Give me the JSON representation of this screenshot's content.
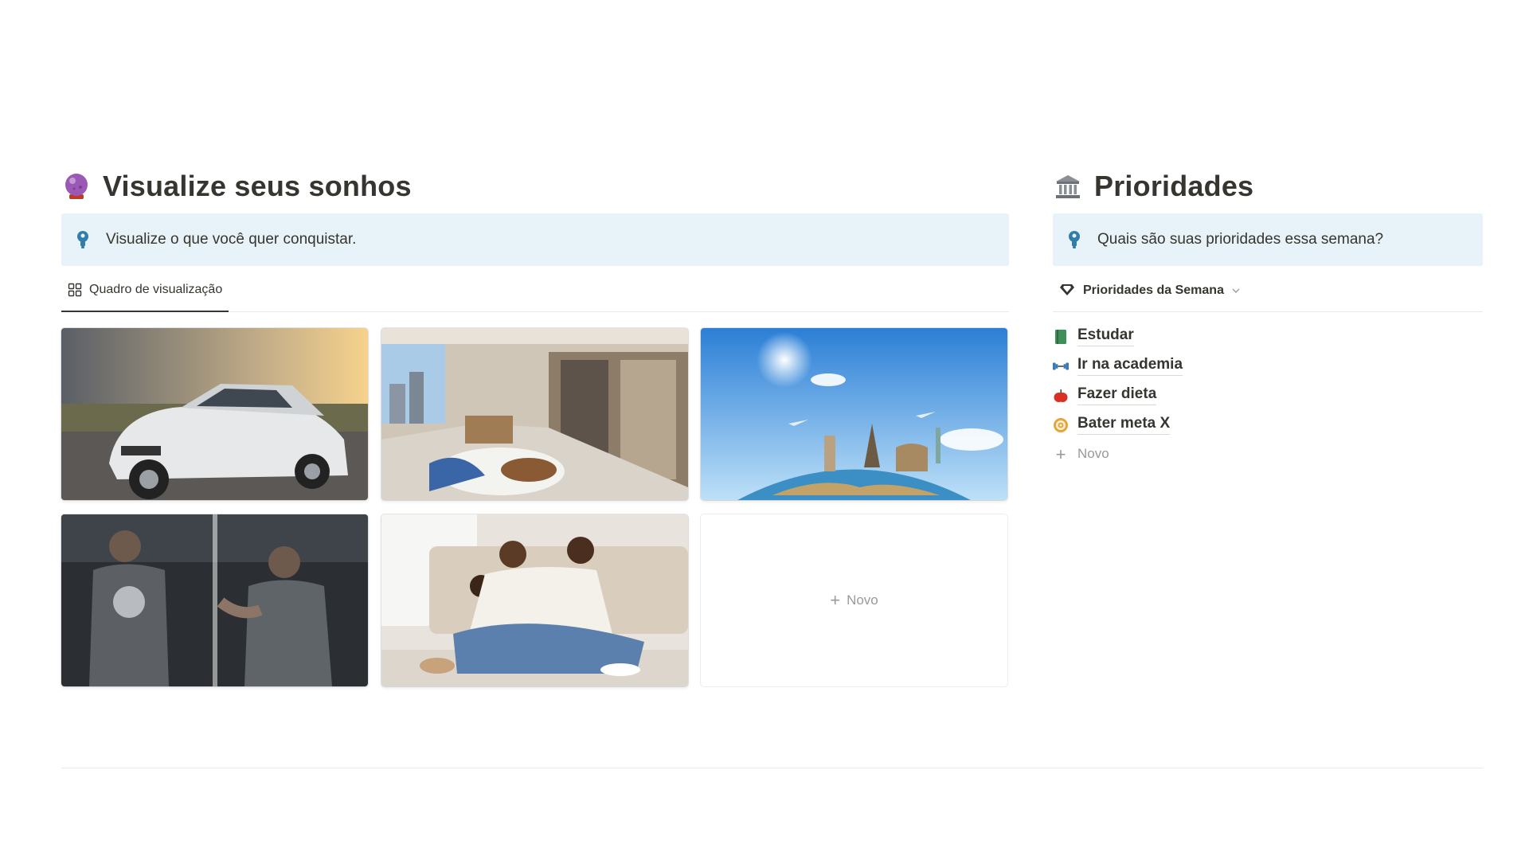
{
  "left": {
    "heading": "Visualize seus sonhos",
    "heading_icon": "crystal-ball-icon",
    "callout": "Visualize o que você quer conquistar.",
    "callout_icon": "lightbulb-icon",
    "tab_label": "Quadro de visualização",
    "tab_icon": "gallery-grid-icon",
    "cards": [
      {
        "image": "car-photo"
      },
      {
        "image": "apartment-balcony-photo"
      },
      {
        "image": "world-travel-photo"
      },
      {
        "image": "gym-workout-photo"
      },
      {
        "image": "family-photo"
      }
    ],
    "new_label": "Novo"
  },
  "right": {
    "heading": "Prioridades",
    "heading_icon": "classical-building-icon",
    "callout": "Quais são suas prioridades essa semana?",
    "callout_icon": "lightbulb-icon",
    "db_title": "Prioridades da Semana",
    "db_icon": "gem-icon",
    "items": [
      {
        "label": "Estudar",
        "icon": "green-book-icon"
      },
      {
        "label": "Ir na academia",
        "icon": "dumbbell-icon"
      },
      {
        "label": "Fazer dieta",
        "icon": "apple-icon"
      },
      {
        "label": "Bater meta X",
        "icon": "target-icon"
      }
    ],
    "new_label": "Novo"
  },
  "colors": {
    "callout_bg": "#e7f3f8",
    "text": "#37352f",
    "muted": "#9b9a97"
  }
}
